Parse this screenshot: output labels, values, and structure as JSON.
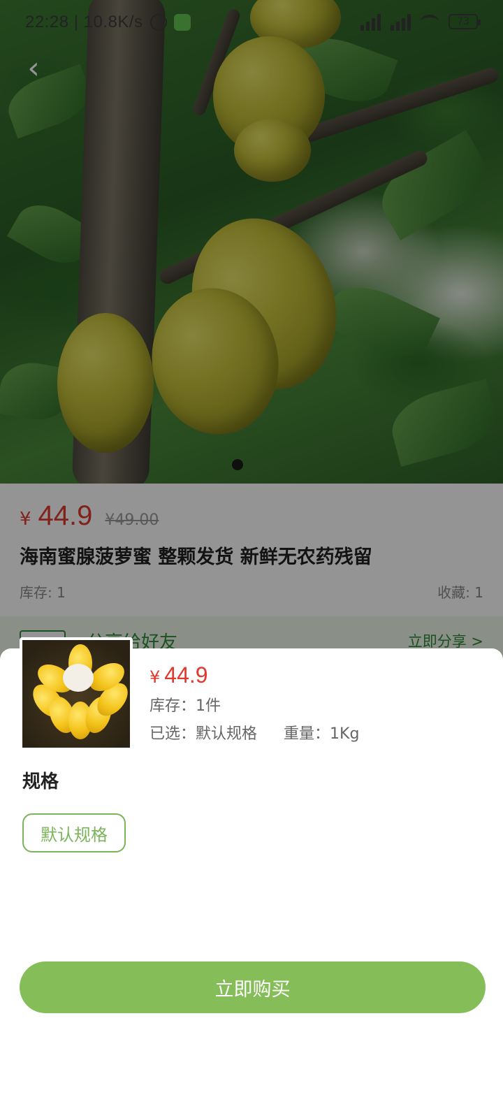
{
  "status_bar": {
    "time": "22:28 | 10.8K/s",
    "battery": "73"
  },
  "product": {
    "currency_symbol": "¥",
    "price": "44.9",
    "original_price": "¥49.00",
    "title": "海南蜜腺菠萝蜜 整颗发货 新鲜无农药残留",
    "stock": "库存: 1",
    "favorites": "收藏: 1"
  },
  "share_bar": {
    "label": "分享给好友",
    "action": "立即分享 >"
  },
  "sheet": {
    "currency_symbol": "¥",
    "price": "44.9",
    "stock": "库存：1件",
    "selected": "已选：默认规格",
    "weight": "重量：1Kg",
    "spec_title": "规格",
    "spec_option": "默认规格",
    "buy_button": "立即购买"
  },
  "colors": {
    "accent_green": "#85be58",
    "price_red": "#e03a2f"
  }
}
